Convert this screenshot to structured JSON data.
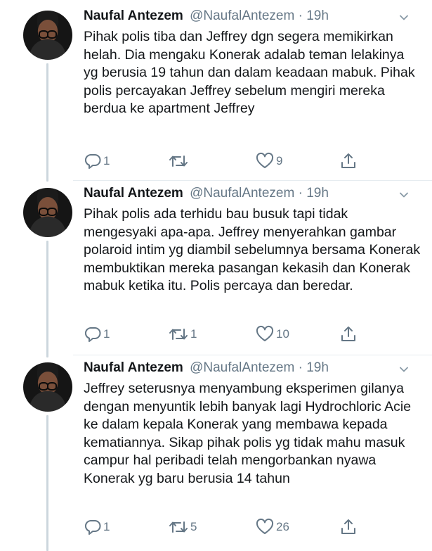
{
  "tweets": [
    {
      "name": "Naufal Antezem",
      "handle": "@NaufalAntezem",
      "separator": "·",
      "time": "19h",
      "text": "Pihak polis tiba dan Jeffrey dgn segera memikirkan helah. Dia mengaku Konerak adalab teman lelakinya yg berusia 19 tahun dan dalam keadaan mabuk. Pihak polis percayakan Jeffrey sebelum mengiri mereka berdua ke apartment Jeffrey",
      "replies": "1",
      "retweets": "",
      "likes": "9",
      "share": ""
    },
    {
      "name": "Naufal Antezem",
      "handle": "@NaufalAntezem",
      "separator": "·",
      "time": "19h",
      "text": "Pihak polis ada terhidu bau busuk tapi tidak mengesyaki apa-apa. Jeffrey menyerahkan gambar polaroid intim yg diambil sebelumnya bersama Konerak membuktikan mereka pasangan kekasih dan Konerak mabuk ketika itu. Polis percaya dan beredar.",
      "replies": "1",
      "retweets": "1",
      "likes": "10",
      "share": ""
    },
    {
      "name": "Naufal Antezem",
      "handle": "@NaufalAntezem",
      "separator": "·",
      "time": "19h",
      "text": "Jeffrey seterusnya menyambung eksperimen gilanya dengan menyuntik lebih banyak lagi Hydrochloric Acie ke dalam kepala Konerak yang membawa kepada kematiannya. Sikap pihak polis yg tidak mahu masuk campur hal peribadi telah mengorbankan nyawa Konerak yg baru berusia 14 tahun",
      "replies": "1",
      "retweets": "5",
      "likes": "26",
      "share": ""
    }
  ],
  "icons": {
    "reply": "reply-icon",
    "retweet": "retweet-icon",
    "like": "heart-icon",
    "share": "share-icon",
    "menu": "chevron-down-icon"
  },
  "colors": {
    "text": "#14171a",
    "secondary": "#657786",
    "thread_line": "#ccd6dd",
    "divider": "#e6ecf0",
    "background": "#ffffff"
  }
}
